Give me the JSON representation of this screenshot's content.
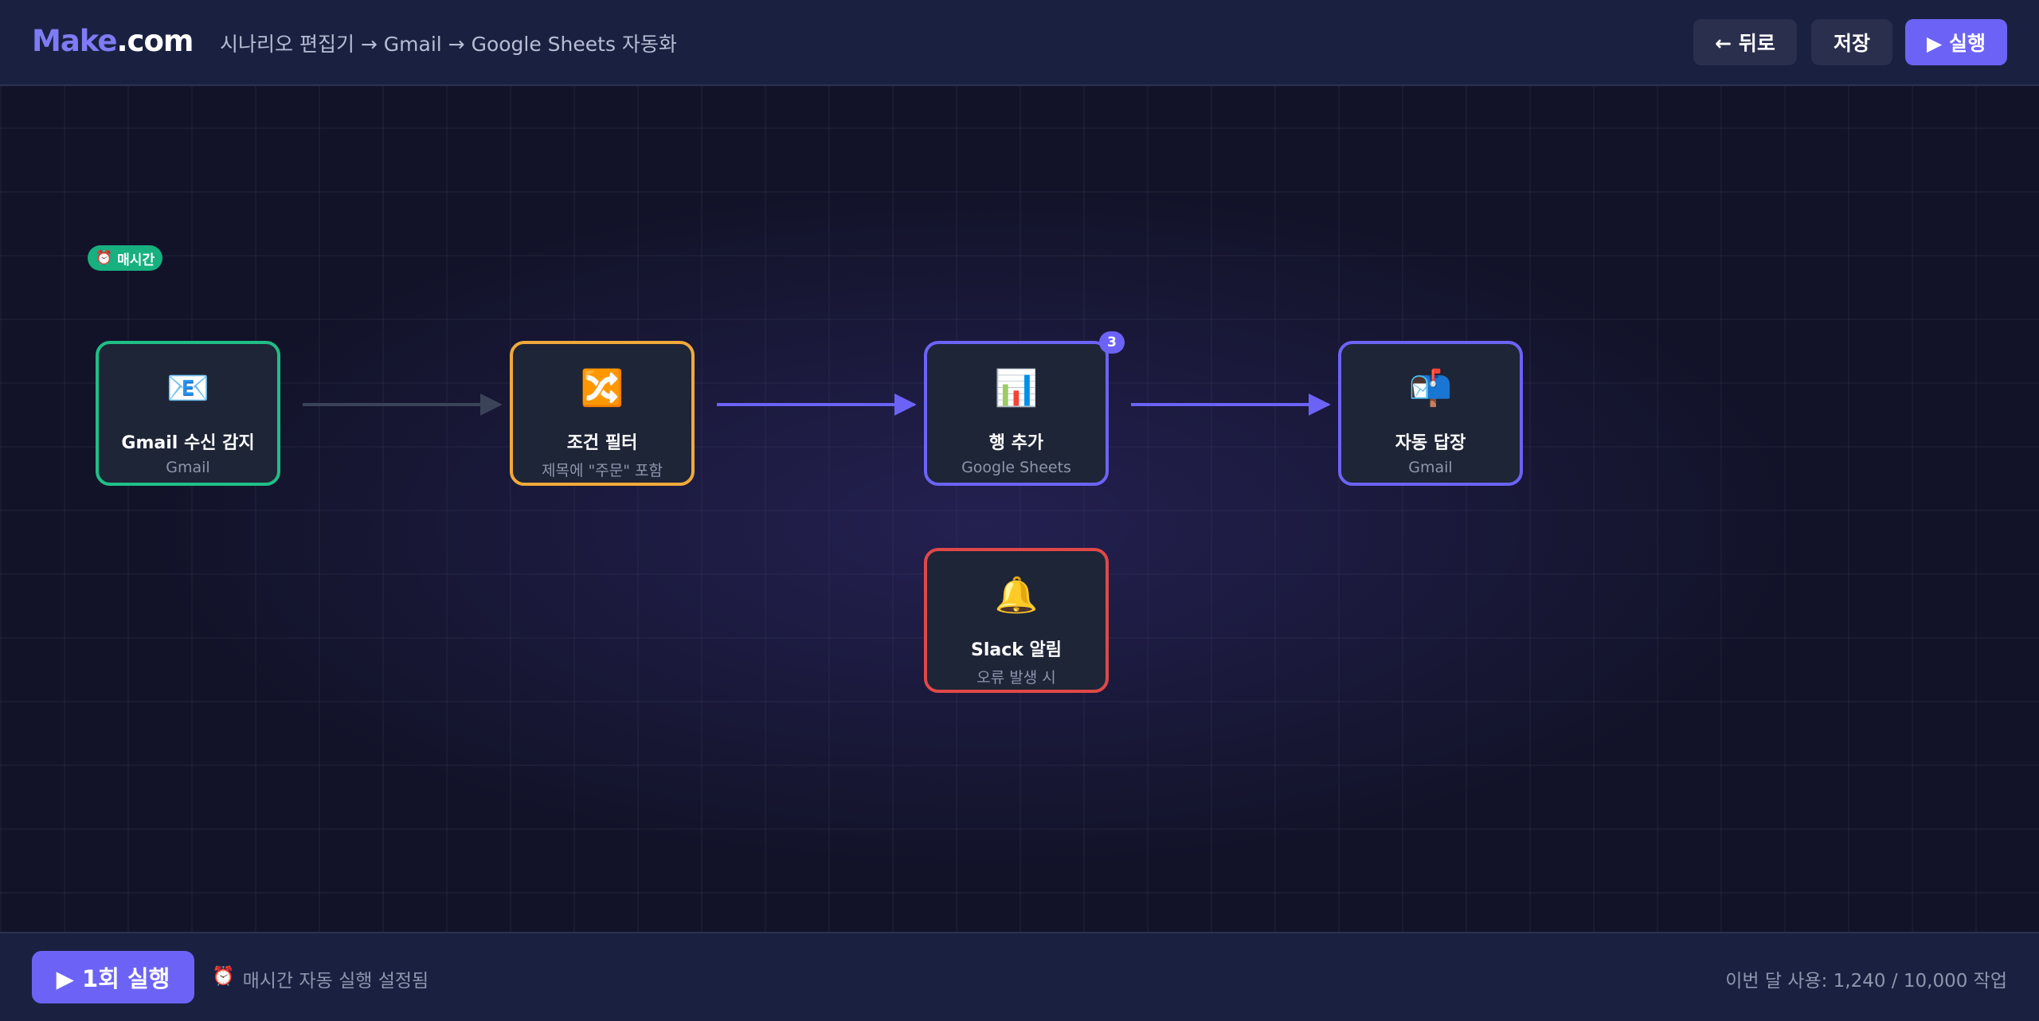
{
  "header": {
    "logo_main": "Make",
    "logo_suffix": ".com",
    "breadcrumb": "시나리오 편집기 → Gmail → Google Sheets 자동화",
    "back_label": "← 뒤로",
    "save_label": "저장",
    "run_label": "▶ 실행"
  },
  "nodes": {
    "gmail_trigger": {
      "icon": "📧",
      "title": "Gmail 수신 감지",
      "subtitle": "Gmail",
      "badge_icon": "⏰",
      "badge": "매시간"
    },
    "filter": {
      "icon": "🔀",
      "title": "조건 필터",
      "subtitle": "제목에 \"주문\" 포함"
    },
    "sheets": {
      "icon": "📊",
      "title": "행 추가",
      "subtitle": "Google Sheets",
      "badge": "3"
    },
    "auto_reply": {
      "icon": "📬",
      "title": "자동 답장",
      "subtitle": "Gmail"
    },
    "slack": {
      "icon": "🔔",
      "title": "Slack 알림",
      "subtitle": "오류 발생 시"
    }
  },
  "footer": {
    "run_once_label": "▶ 1회 실행",
    "schedule_icon": "⏰",
    "schedule_status": "매시간 자동 실행 설정됨",
    "usage": "이번 달 사용: 1,240 / 10,000 작업"
  },
  "colors": {
    "accent": "#6c63f6",
    "trigger": "#1fbf86",
    "filter": "#f0a93a",
    "error": "#e04848"
  }
}
